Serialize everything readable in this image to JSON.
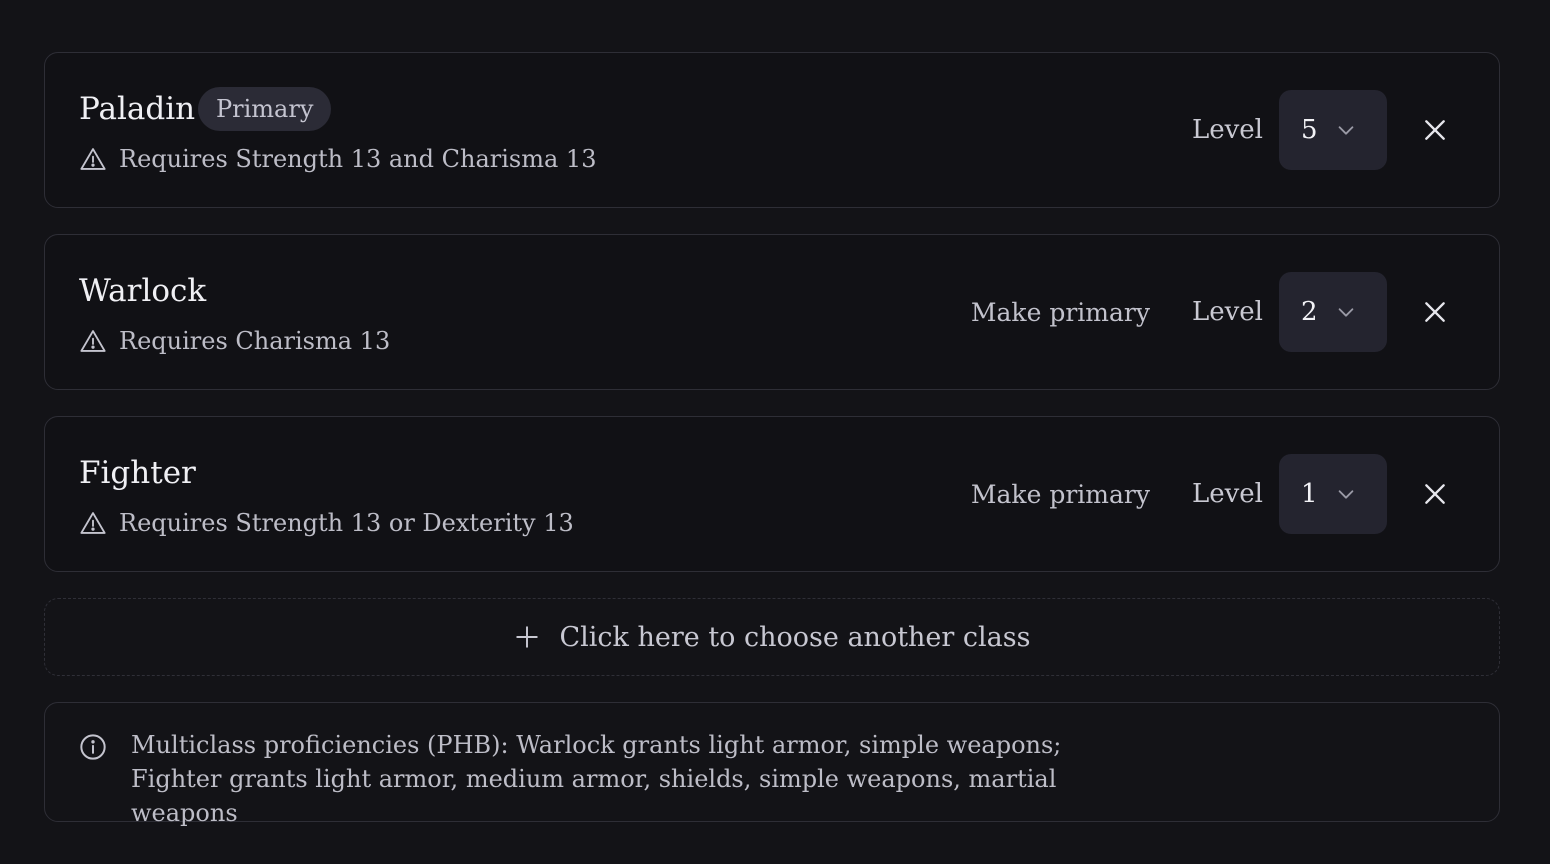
{
  "classes": [
    {
      "name": "Paladin",
      "badge": "Primary",
      "requirement": "Requires Strength 13 and Charisma 13",
      "level_label": "Level",
      "level": "5",
      "icons": {
        "warning": "warning-triangle-icon",
        "chevron": "chevron-down-icon",
        "remove": "close-icon"
      }
    },
    {
      "name": "Warlock",
      "make_primary": "Make primary",
      "requirement": "Requires Charisma 13",
      "level_label": "Level",
      "level": "2",
      "icons": {
        "warning": "warning-triangle-icon",
        "chevron": "chevron-down-icon",
        "remove": "close-icon"
      }
    },
    {
      "name": "Fighter",
      "make_primary": "Make primary",
      "requirement": "Requires Strength 13 or Dexterity 13",
      "level_label": "Level",
      "level": "1",
      "icons": {
        "warning": "warning-triangle-icon",
        "chevron": "chevron-down-icon",
        "remove": "close-icon"
      }
    }
  ],
  "add_class": {
    "label": "Click here to choose another class",
    "icon": "plus-icon"
  },
  "info": {
    "icon": "info-circle-icon",
    "text": "Multiclass proficiencies (PHB): Warlock grants light armor, simple weapons; Fighter grants light armor, medium armor, shields, simple weapons, martial weapons"
  },
  "colors": {
    "background": "#131317",
    "card_border": "#2e2e36",
    "badge_bg": "#2b2b36",
    "select_bg": "#24242f",
    "text_primary": "#f0f0f4",
    "text_secondary": "#bdbdc7"
  }
}
